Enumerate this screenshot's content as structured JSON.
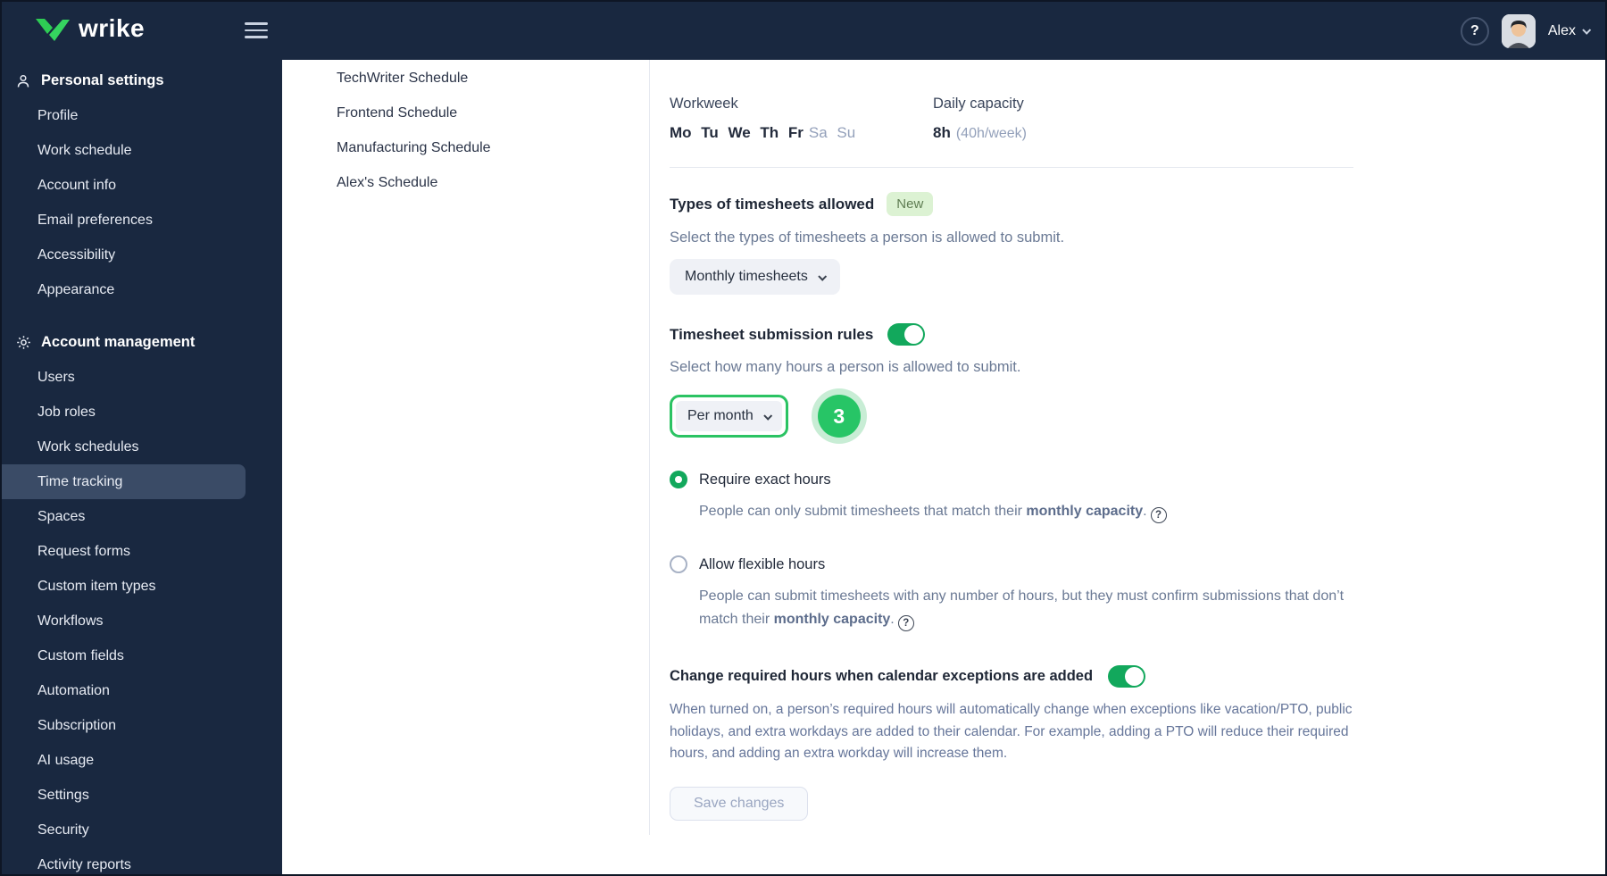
{
  "topbar": {
    "logo_text": "wrike",
    "help_label": "?",
    "user_name": "Alex"
  },
  "sidebar": {
    "selected_item": "Time tracking",
    "sections": [
      {
        "label": "Personal settings",
        "icon": "person-icon",
        "items": [
          "Profile",
          "Work schedule",
          "Account info",
          "Email preferences",
          "Accessibility",
          "Appearance"
        ]
      },
      {
        "label": "Account management",
        "icon": "gear-icon",
        "items": [
          "Users",
          "Job roles",
          "Work schedules",
          "Time tracking",
          "Spaces",
          "Request forms",
          "Custom item types",
          "Workflows",
          "Custom fields",
          "Automation",
          "Subscription",
          "AI usage",
          "Settings",
          "Security",
          "Activity reports"
        ]
      }
    ]
  },
  "schedules_panel": {
    "items": [
      "TechWriter Schedule",
      "Frontend Schedule",
      "Manufacturing Schedule",
      "Alex's Schedule"
    ]
  },
  "main": {
    "workweek": {
      "label": "Workweek",
      "active_days": "Mo Tu We Th Fr",
      "inactive_days": "Sa Su"
    },
    "daily_capacity": {
      "label": "Daily capacity",
      "value": "8h",
      "note": "(40h/week)"
    },
    "timesheet_types": {
      "title": "Types of timesheets allowed",
      "badge": "New",
      "description": "Select the types of timesheets a person is allowed to submit.",
      "dropdown_value": "Monthly timesheets"
    },
    "submission_rules": {
      "title": "Timesheet submission rules",
      "toggle_on": true,
      "description": "Select how many hours a person is allowed to submit.",
      "period_dropdown_value": "Per month",
      "step_badge": "3",
      "options": [
        {
          "label": "Require exact hours",
          "selected": true,
          "description_prefix": "People can only submit timesheets that match their ",
          "description_bold": "monthly capacity",
          "description_suffix": "."
        },
        {
          "label": "Allow flexible hours",
          "selected": false,
          "description_prefix": "People can submit timesheets with any number of hours, but they must confirm submissions that don’t match their ",
          "description_bold": "monthly capacity",
          "description_suffix": "."
        }
      ]
    },
    "calendar_exceptions": {
      "title": "Change required hours when calendar exceptions are added",
      "toggle_on": true,
      "description": "When turned on, a person’s required hours will automatically change when exceptions like vacation/PTO, public holidays, and extra workdays are added to their calendar. For example, adding a PTO will reduce their required hours, and adding an extra workday will increase them."
    },
    "save_button": "Save changes"
  },
  "colors": {
    "nav_background": "#192840",
    "nav_selected": "#3a4b66",
    "accent_green": "#12a85c",
    "highlight_green": "#2bc363",
    "badge_green": "#27c566",
    "new_badge_bg": "#dcf2d3",
    "text_dark": "#1f2736",
    "text_muted": "#6a7994"
  }
}
